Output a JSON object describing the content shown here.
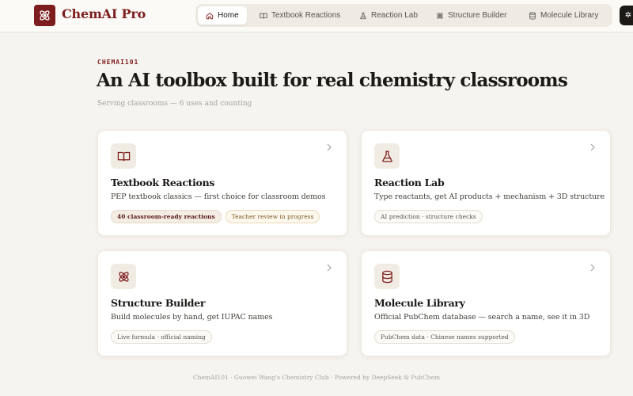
{
  "brand": {
    "name": "ChemAI Pro"
  },
  "nav": {
    "items": [
      {
        "label": "Home",
        "icon": "home-icon",
        "active": true
      },
      {
        "label": "Textbook Reactions",
        "icon": "book-icon",
        "active": false
      },
      {
        "label": "Reaction Lab",
        "icon": "flask-icon",
        "active": false
      },
      {
        "label": "Structure Builder",
        "icon": "atom-icon",
        "active": false
      },
      {
        "label": "Molecule Library",
        "icon": "database-icon",
        "active": false
      }
    ],
    "extra_button_icon": "sparkle-icon"
  },
  "hero": {
    "eyebrow": "CHEMAI101",
    "title": "An AI toolbox built for real chemistry classrooms",
    "subtitle": "Serving classrooms — 6 uses and counting"
  },
  "cards": [
    {
      "title": "Textbook Reactions",
      "description": "PEP textbook classics — first choice for classroom demos",
      "icon": "book-icon",
      "tags": [
        {
          "label": "40 classroom-ready reactions",
          "style": "strong"
        },
        {
          "label": "Teacher review in progress",
          "style": "warn"
        }
      ]
    },
    {
      "title": "Reaction Lab",
      "description": "Type reactants, get AI products + mechanism + 3D structure",
      "icon": "flask-icon",
      "tags": [
        {
          "label": "AI prediction · structure checks",
          "style": "plain"
        }
      ]
    },
    {
      "title": "Structure Builder",
      "description": "Build molecules by hand, get IUPAC names",
      "icon": "atom-icon",
      "tags": [
        {
          "label": "Live formula · official naming",
          "style": "plain"
        }
      ]
    },
    {
      "title": "Molecule Library",
      "description": "Official PubChem database — search a name, see it in 3D",
      "icon": "database-icon",
      "tags": [
        {
          "label": "PubChem data · Chinese names supported",
          "style": "plain"
        }
      ]
    }
  ],
  "footer": {
    "text": "ChemAI101 · Guowei Wang's Chemistry Club · Powered by DeepSeek & PubChem"
  },
  "colors": {
    "accent": "#7d1d1d",
    "background": "#f6f4f0",
    "icon_bg": "#f1ece3"
  }
}
